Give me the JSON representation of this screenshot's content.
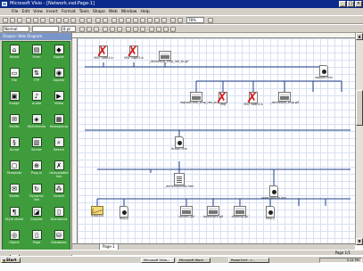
{
  "window": {
    "title": "Microsoft Visio - [Network.vsd:Page-1]"
  },
  "menu": [
    "File",
    "Edit",
    "View",
    "Insert",
    "Format",
    "Tools",
    "Shape",
    "Web",
    "Window",
    "Help"
  ],
  "toolbar": {
    "font_combo": "Normal",
    "size_combo": "8 pt",
    "zoom_combo": "78%"
  },
  "shapes_panel": {
    "title": "Shapes: Web Diagram",
    "items": [
      {
        "label": "Home",
        "icon": "home-icon"
      },
      {
        "label": "Form",
        "icon": "form-icon"
      },
      {
        "label": "Applet",
        "icon": "applet-icon"
      },
      {
        "label": "File",
        "icon": "file-icon"
      },
      {
        "label": "FTP",
        "icon": "ftp-icon"
      },
      {
        "label": "Gopher",
        "icon": "gopher-icon"
      },
      {
        "label": "Image",
        "icon": "image-icon"
      },
      {
        "label": "Audio",
        "icon": "audio-icon"
      },
      {
        "label": "Video",
        "icon": "video-icon"
      },
      {
        "label": "Mailto",
        "icon": "mail-icon"
      },
      {
        "label": "Multimedia",
        "icon": "multimedia-icon"
      },
      {
        "label": "Newsgroup",
        "icon": "news-icon"
      },
      {
        "label": "Script",
        "icon": "script-icon"
      },
      {
        "label": "Server",
        "icon": "server-icon"
      },
      {
        "label": "Search",
        "icon": "search-icon"
      },
      {
        "label": "Template",
        "icon": "template-icon"
      },
      {
        "label": "Plug-in",
        "icon": "plugin-icon"
      },
      {
        "label": "Unavailable link",
        "icon": "broken-link-icon"
      },
      {
        "label": "Mailto",
        "icon": "mail-icon"
      },
      {
        "label": "Dynamic link",
        "icon": "dynamic-link-icon"
      },
      {
        "label": "Cluster",
        "icon": "cluster-icon"
      },
      {
        "label": "Style sheet",
        "icon": "style-icon"
      },
      {
        "label": "Graphic",
        "icon": "graphic-icon"
      },
      {
        "label": "Document",
        "icon": "document-icon"
      },
      {
        "label": "Object",
        "icon": "object-icon"
      },
      {
        "label": "Page",
        "icon": "page-icon"
      },
      {
        "label": "Database",
        "icon": "database-icon"
      },
      {
        "label": "Other link",
        "icon": "link-icon"
      }
    ]
  },
  "diagram": {
    "nodes": [
      {
        "label": "MSFTWan4.b",
        "type": "broken"
      },
      {
        "label": "MSFTWan5.b",
        "type": "broken"
      },
      {
        "label": "_derived/ie_cmp_net_sk.gif",
        "type": "image"
      },
      {
        "label": "register.htm",
        "type": "page"
      },
      {
        "label": "register.htm_cmp_net_sk.gif",
        "type": "image"
      },
      {
        "label": "img",
        "type": "broken"
      },
      {
        "label": "MSFTWan4.b",
        "type": "broken"
      },
      {
        "label": "_derived/ie_cmp.gif",
        "type": "image"
      },
      {
        "label": "fiction.htm",
        "type": "page"
      },
      {
        "label": "_derived/fiction.htm",
        "type": "folder"
      },
      {
        "label": "www.libolcm.org",
        "type": "page"
      },
      {
        "label": "mailto:a",
        "type": "mail"
      },
      {
        "label": "http://",
        "type": "page"
      },
      {
        "label": "column.gif",
        "type": "image"
      },
      {
        "label": "bookmark.gif",
        "type": "image"
      },
      {
        "label": "thebirds.gif",
        "type": "image"
      },
      {
        "label": "http://",
        "type": "page"
      }
    ]
  },
  "page_tab": "Page-1",
  "status": {
    "left": "",
    "right": "Page 1/1"
  },
  "taskbar": {
    "start": "Start",
    "buttons": [
      "Microsoft Visio...",
      "Microsoft Word",
      "PowerCert - I..."
    ],
    "clock": "3:14 PM"
  },
  "colors": {
    "stencil": "#3f9c3c",
    "title": "#0b2a8a",
    "broken": "#d42020"
  }
}
